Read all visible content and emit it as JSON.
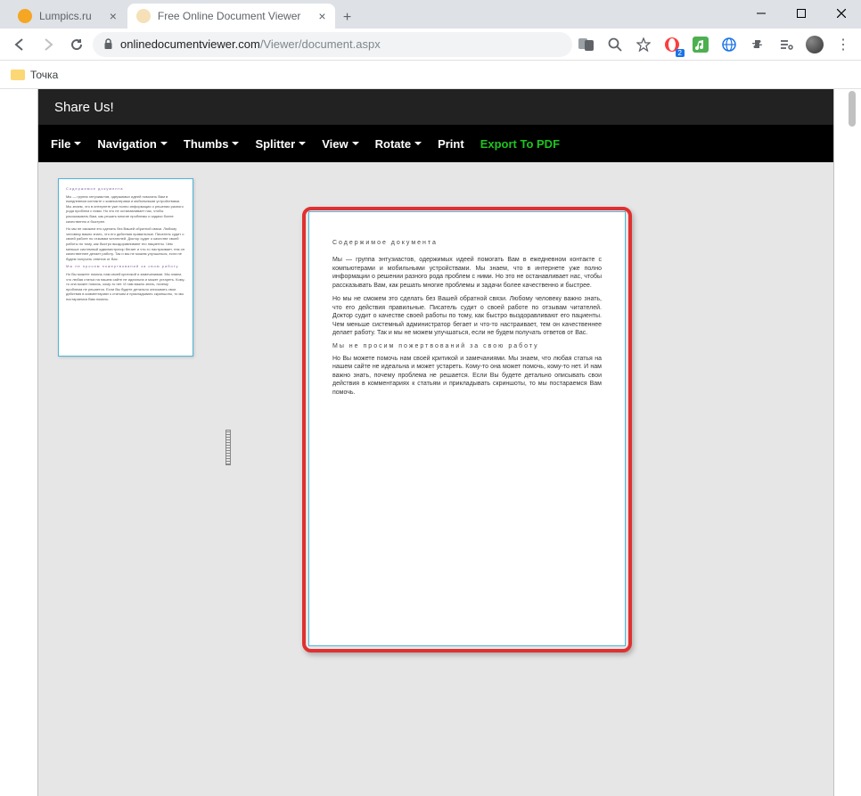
{
  "tabs": [
    {
      "title": "Lumpics.ru",
      "favicon_color": "#f5a623"
    },
    {
      "title": "Free Online Document Viewer",
      "favicon_color": "#d4a94e"
    }
  ],
  "url": {
    "domain": "onlinedocumentviewer.com",
    "path": "/Viewer/document.aspx"
  },
  "bookmarks": {
    "item1": "Точка"
  },
  "ext_badge": "2",
  "viewer": {
    "share_label": "Share Us!",
    "menu": {
      "file": "File",
      "navigation": "Navigation",
      "thumbs": "Thumbs",
      "splitter": "Splitter",
      "view": "View",
      "rotate": "Rotate",
      "print": "Print",
      "export": "Export To PDF"
    }
  },
  "document": {
    "title": "Содержимое документа",
    "p1": "Мы — группа энтузиастов, одержимых идеей помогать Вам в ежедневном контакте с компьютерами и мобильными устройствами. Мы знаем, что в интернете уже полно информации о решении разного рода проблем с ними. Но это не останавливает нас, чтобы рассказывать Вам, как решать многие проблемы и задачи более качественно и быстрее.",
    "p2": "Но мы не сможем это сделать без Вашей обратной связи. Любому человеку важно знать, что его действия правильные. Писатель судит о своей работе по отзывам читателей. Доктор судит о качестве своей работы по тому, как быстро выздоравливают его пациенты. Чем меньше системный администратор бегает и что-то настраивает, тем он качественнее делает работу. Так и мы не можем улучшаться, если не будем получать ответов от Вас.",
    "h2": "Мы не просим пожертвований за свою работу",
    "p3": "Но Вы можете помочь нам своей критикой и замечаниями. Мы знаем, что любая статья на нашем сайте не идеальна и может устареть. Кому-то она может помочь, кому-то нет. И нам важно знать, почему проблема не решается. Если Вы будете детально описывать свои действия в комментариях к статьям и прикладывать скриншоты, то мы постараемся Вам помочь."
  }
}
